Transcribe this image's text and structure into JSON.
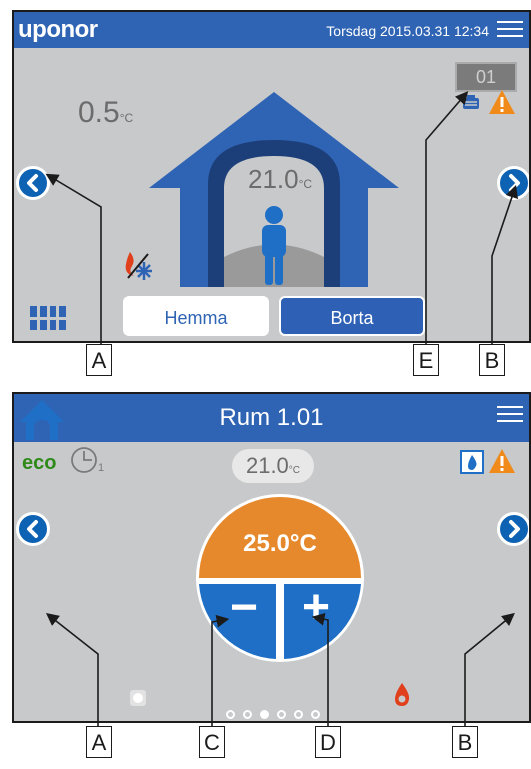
{
  "screen1": {
    "brand": "uponor",
    "datetime": "Torsdag 2015.03.31 12:34",
    "outdoor_temp": "0.5",
    "outdoor_unit": "°C",
    "room_temp": "21.0",
    "room_unit": "°C",
    "room_number": "01",
    "mode_buttons": [
      "Hemma",
      "Borta"
    ],
    "icons": [
      "menu-icon",
      "back-arrow-icon",
      "forward-arrow-icon",
      "grid-menu-icon",
      "heating-cooling-icon",
      "comfort-profile-icon",
      "warning-icon",
      "person-icon",
      "house-icon"
    ]
  },
  "screen2": {
    "room_title": "Rum 1.01",
    "eco_label": "eco",
    "timer_subscript": "1",
    "room_temp": "21.0",
    "room_unit": "°C",
    "setpoint": "25.0",
    "setpoint_unit": "°C",
    "decrease_symbol": "−",
    "increase_symbol": "+",
    "page_dots": {
      "count": 6,
      "active": 2
    },
    "icons": [
      "home-icon",
      "menu-icon",
      "clock-icon",
      "water-drop-icon",
      "warning-icon",
      "flame-icon",
      "back-arrow-icon",
      "forward-arrow-icon"
    ]
  },
  "callouts": [
    "A",
    "E",
    "B",
    "A",
    "C",
    "D",
    "B"
  ],
  "colors": {
    "accent_blue": "#2f64b4",
    "panel_gray": "#c8c9cb",
    "warning_orange": "#f08a1b",
    "setpoint_orange": "#e6892c"
  }
}
